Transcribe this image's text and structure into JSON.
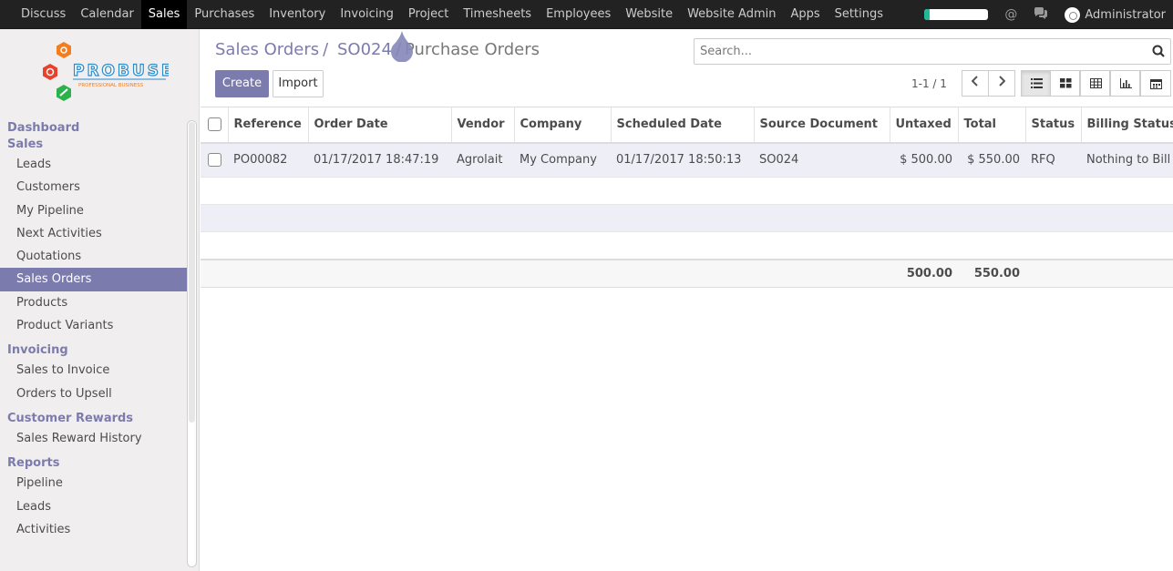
{
  "topnav": {
    "menu": [
      "Discuss",
      "Calendar",
      "Sales",
      "Purchases",
      "Inventory",
      "Invoicing",
      "Project",
      "Timesheets",
      "Employees",
      "Website",
      "Website Admin",
      "Apps",
      "Settings"
    ],
    "active": "Sales",
    "user": "Administrator",
    "accent": "#21b799"
  },
  "logo": {
    "name": "PROBUSE",
    "tagline": "PROFESSIONAL BUSINESS"
  },
  "sidebar": {
    "sections": [
      {
        "title": "Dashboard",
        "items": []
      },
      {
        "title": "Sales",
        "items": [
          "Leads",
          "Customers",
          "My Pipeline",
          "Next Activities",
          "Quotations",
          "Sales Orders",
          "Products",
          "Product Variants"
        ]
      },
      {
        "title": "Invoicing",
        "items": [
          "Sales to Invoice",
          "Orders to Upsell"
        ]
      },
      {
        "title": "Customer Rewards",
        "items": [
          "Sales Reward History"
        ]
      },
      {
        "title": "Reports",
        "items": [
          "Pipeline",
          "Leads",
          "Activities"
        ]
      }
    ],
    "active_item": "Sales Orders",
    "accent": "#7c7bad"
  },
  "breadcrumb": {
    "items": [
      "Sales Orders",
      "SO024"
    ],
    "separator": "/",
    "current": "Purchase Orders"
  },
  "search": {
    "placeholder": "Search..."
  },
  "buttons": {
    "create": "Create",
    "import": "Import"
  },
  "pager": {
    "value": "1-1 / 1"
  },
  "table": {
    "columns": [
      "Reference",
      "Order Date",
      "Vendor",
      "Company",
      "Scheduled Date",
      "Source Document",
      "Untaxed",
      "Total",
      "Status",
      "Billing Status"
    ],
    "rows": [
      [
        "PO00082",
        "01/17/2017 18:47:19",
        "Agrolait",
        "My Company",
        "01/17/2017 18:50:13",
        "SO024",
        "$ 500.00",
        "$ 550.00",
        "RFQ",
        "Nothing to Bill"
      ]
    ],
    "totals": {
      "untaxed": "500.00",
      "total": "550.00"
    }
  }
}
